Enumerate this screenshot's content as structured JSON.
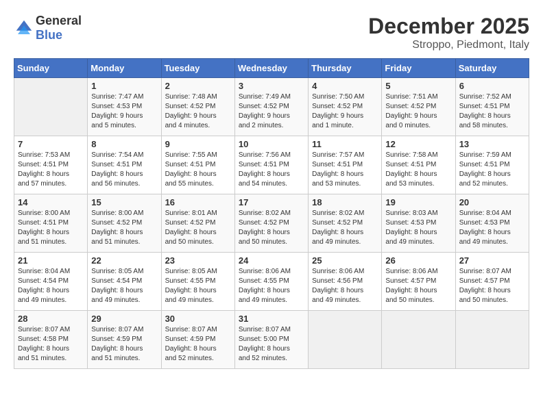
{
  "header": {
    "logo_general": "General",
    "logo_blue": "Blue",
    "month_title": "December 2025",
    "subtitle": "Stroppo, Piedmont, Italy"
  },
  "days_of_week": [
    "Sunday",
    "Monday",
    "Tuesday",
    "Wednesday",
    "Thursday",
    "Friday",
    "Saturday"
  ],
  "weeks": [
    [
      {
        "day": "",
        "info": ""
      },
      {
        "day": "1",
        "info": "Sunrise: 7:47 AM\nSunset: 4:53 PM\nDaylight: 9 hours\nand 5 minutes."
      },
      {
        "day": "2",
        "info": "Sunrise: 7:48 AM\nSunset: 4:52 PM\nDaylight: 9 hours\nand 4 minutes."
      },
      {
        "day": "3",
        "info": "Sunrise: 7:49 AM\nSunset: 4:52 PM\nDaylight: 9 hours\nand 2 minutes."
      },
      {
        "day": "4",
        "info": "Sunrise: 7:50 AM\nSunset: 4:52 PM\nDaylight: 9 hours\nand 1 minute."
      },
      {
        "day": "5",
        "info": "Sunrise: 7:51 AM\nSunset: 4:52 PM\nDaylight: 9 hours\nand 0 minutes."
      },
      {
        "day": "6",
        "info": "Sunrise: 7:52 AM\nSunset: 4:51 PM\nDaylight: 8 hours\nand 58 minutes."
      }
    ],
    [
      {
        "day": "7",
        "info": "Sunrise: 7:53 AM\nSunset: 4:51 PM\nDaylight: 8 hours\nand 57 minutes."
      },
      {
        "day": "8",
        "info": "Sunrise: 7:54 AM\nSunset: 4:51 PM\nDaylight: 8 hours\nand 56 minutes."
      },
      {
        "day": "9",
        "info": "Sunrise: 7:55 AM\nSunset: 4:51 PM\nDaylight: 8 hours\nand 55 minutes."
      },
      {
        "day": "10",
        "info": "Sunrise: 7:56 AM\nSunset: 4:51 PM\nDaylight: 8 hours\nand 54 minutes."
      },
      {
        "day": "11",
        "info": "Sunrise: 7:57 AM\nSunset: 4:51 PM\nDaylight: 8 hours\nand 53 minutes."
      },
      {
        "day": "12",
        "info": "Sunrise: 7:58 AM\nSunset: 4:51 PM\nDaylight: 8 hours\nand 53 minutes."
      },
      {
        "day": "13",
        "info": "Sunrise: 7:59 AM\nSunset: 4:51 PM\nDaylight: 8 hours\nand 52 minutes."
      }
    ],
    [
      {
        "day": "14",
        "info": "Sunrise: 8:00 AM\nSunset: 4:51 PM\nDaylight: 8 hours\nand 51 minutes."
      },
      {
        "day": "15",
        "info": "Sunrise: 8:00 AM\nSunset: 4:52 PM\nDaylight: 8 hours\nand 51 minutes."
      },
      {
        "day": "16",
        "info": "Sunrise: 8:01 AM\nSunset: 4:52 PM\nDaylight: 8 hours\nand 50 minutes."
      },
      {
        "day": "17",
        "info": "Sunrise: 8:02 AM\nSunset: 4:52 PM\nDaylight: 8 hours\nand 50 minutes."
      },
      {
        "day": "18",
        "info": "Sunrise: 8:02 AM\nSunset: 4:52 PM\nDaylight: 8 hours\nand 49 minutes."
      },
      {
        "day": "19",
        "info": "Sunrise: 8:03 AM\nSunset: 4:53 PM\nDaylight: 8 hours\nand 49 minutes."
      },
      {
        "day": "20",
        "info": "Sunrise: 8:04 AM\nSunset: 4:53 PM\nDaylight: 8 hours\nand 49 minutes."
      }
    ],
    [
      {
        "day": "21",
        "info": "Sunrise: 8:04 AM\nSunset: 4:54 PM\nDaylight: 8 hours\nand 49 minutes."
      },
      {
        "day": "22",
        "info": "Sunrise: 8:05 AM\nSunset: 4:54 PM\nDaylight: 8 hours\nand 49 minutes."
      },
      {
        "day": "23",
        "info": "Sunrise: 8:05 AM\nSunset: 4:55 PM\nDaylight: 8 hours\nand 49 minutes."
      },
      {
        "day": "24",
        "info": "Sunrise: 8:06 AM\nSunset: 4:55 PM\nDaylight: 8 hours\nand 49 minutes."
      },
      {
        "day": "25",
        "info": "Sunrise: 8:06 AM\nSunset: 4:56 PM\nDaylight: 8 hours\nand 49 minutes."
      },
      {
        "day": "26",
        "info": "Sunrise: 8:06 AM\nSunset: 4:57 PM\nDaylight: 8 hours\nand 50 minutes."
      },
      {
        "day": "27",
        "info": "Sunrise: 8:07 AM\nSunset: 4:57 PM\nDaylight: 8 hours\nand 50 minutes."
      }
    ],
    [
      {
        "day": "28",
        "info": "Sunrise: 8:07 AM\nSunset: 4:58 PM\nDaylight: 8 hours\nand 51 minutes."
      },
      {
        "day": "29",
        "info": "Sunrise: 8:07 AM\nSunset: 4:59 PM\nDaylight: 8 hours\nand 51 minutes."
      },
      {
        "day": "30",
        "info": "Sunrise: 8:07 AM\nSunset: 4:59 PM\nDaylight: 8 hours\nand 52 minutes."
      },
      {
        "day": "31",
        "info": "Sunrise: 8:07 AM\nSunset: 5:00 PM\nDaylight: 8 hours\nand 52 minutes."
      },
      {
        "day": "",
        "info": ""
      },
      {
        "day": "",
        "info": ""
      },
      {
        "day": "",
        "info": ""
      }
    ]
  ]
}
